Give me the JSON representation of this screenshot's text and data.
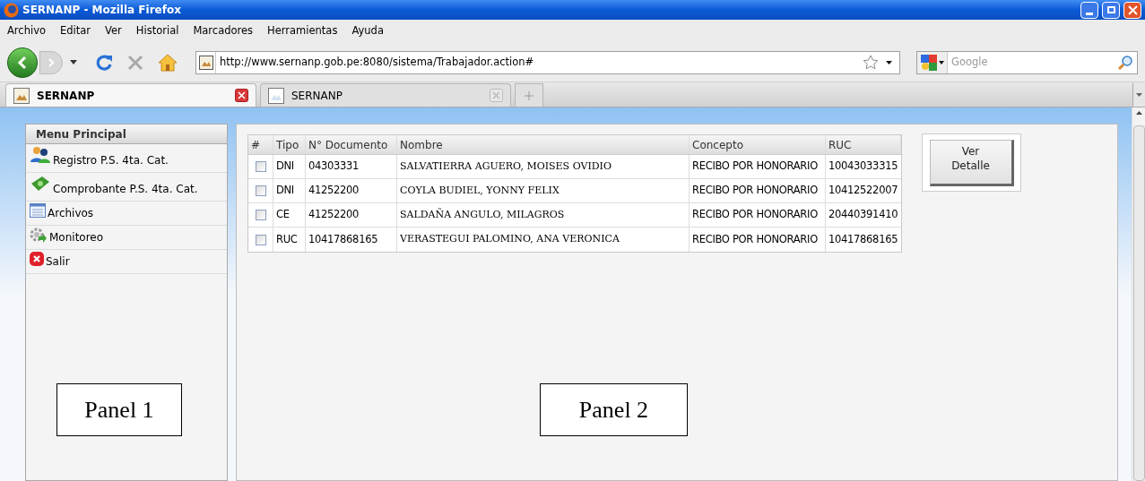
{
  "window": {
    "title": "SERNANP - Mozilla Firefox"
  },
  "menu_bar": [
    "Archivo",
    "Editar",
    "Ver",
    "Historial",
    "Marcadores",
    "Herramientas",
    "Ayuda"
  ],
  "address_bar": {
    "value": "http://www.sernanp.gob.pe:8080/sistema/Trabajador.action#"
  },
  "search": {
    "placeholder": "Google"
  },
  "tabs": [
    {
      "label": "SERNANP",
      "selected": true
    },
    {
      "label": "SERNANP",
      "selected": false
    }
  ],
  "sidebar": {
    "title": "Menu Principal",
    "items": [
      {
        "label": "Registro P.S. 4ta. Cat.",
        "kind": "people"
      },
      {
        "label": "Comprobante P.S. 4ta. Cat.",
        "kind": "money"
      },
      {
        "label": "Archivos",
        "kind": "list"
      },
      {
        "label": "Monitoreo",
        "kind": "gear"
      },
      {
        "label": "Salir",
        "kind": "exit"
      }
    ]
  },
  "table": {
    "columns": [
      "#",
      "Tipo",
      "N° Documento",
      "Nombre",
      "Concepto",
      "RUC"
    ],
    "rows": [
      {
        "checked": false,
        "cells": [
          "",
          "DNI",
          "04303331",
          "SALVATIERRA AGUERO, MOISES OVIDIO",
          "RECIBO POR HONORARIO",
          "10043033315"
        ]
      },
      {
        "checked": false,
        "cells": [
          "",
          "DNI",
          "41252200",
          "COYLA BUDIEL, YONNY FELIX",
          "RECIBO POR HONORARIO",
          "10412522007"
        ]
      },
      {
        "checked": false,
        "cells": [
          "",
          "CE",
          "41252200",
          "SALDAÑA ANGULO, MILAGROS",
          "RECIBO POR HONORARIO",
          "20440391410"
        ]
      },
      {
        "checked": false,
        "cells": [
          "",
          "RUC",
          "10417868165",
          "VERASTEGUI PALOMINO, ANA VERONICA",
          "RECIBO POR HONORARIO",
          "10417868165"
        ]
      }
    ]
  },
  "detail_button": "Ver Detalle",
  "annotations": [
    "Panel 1",
    "Panel 2"
  ]
}
